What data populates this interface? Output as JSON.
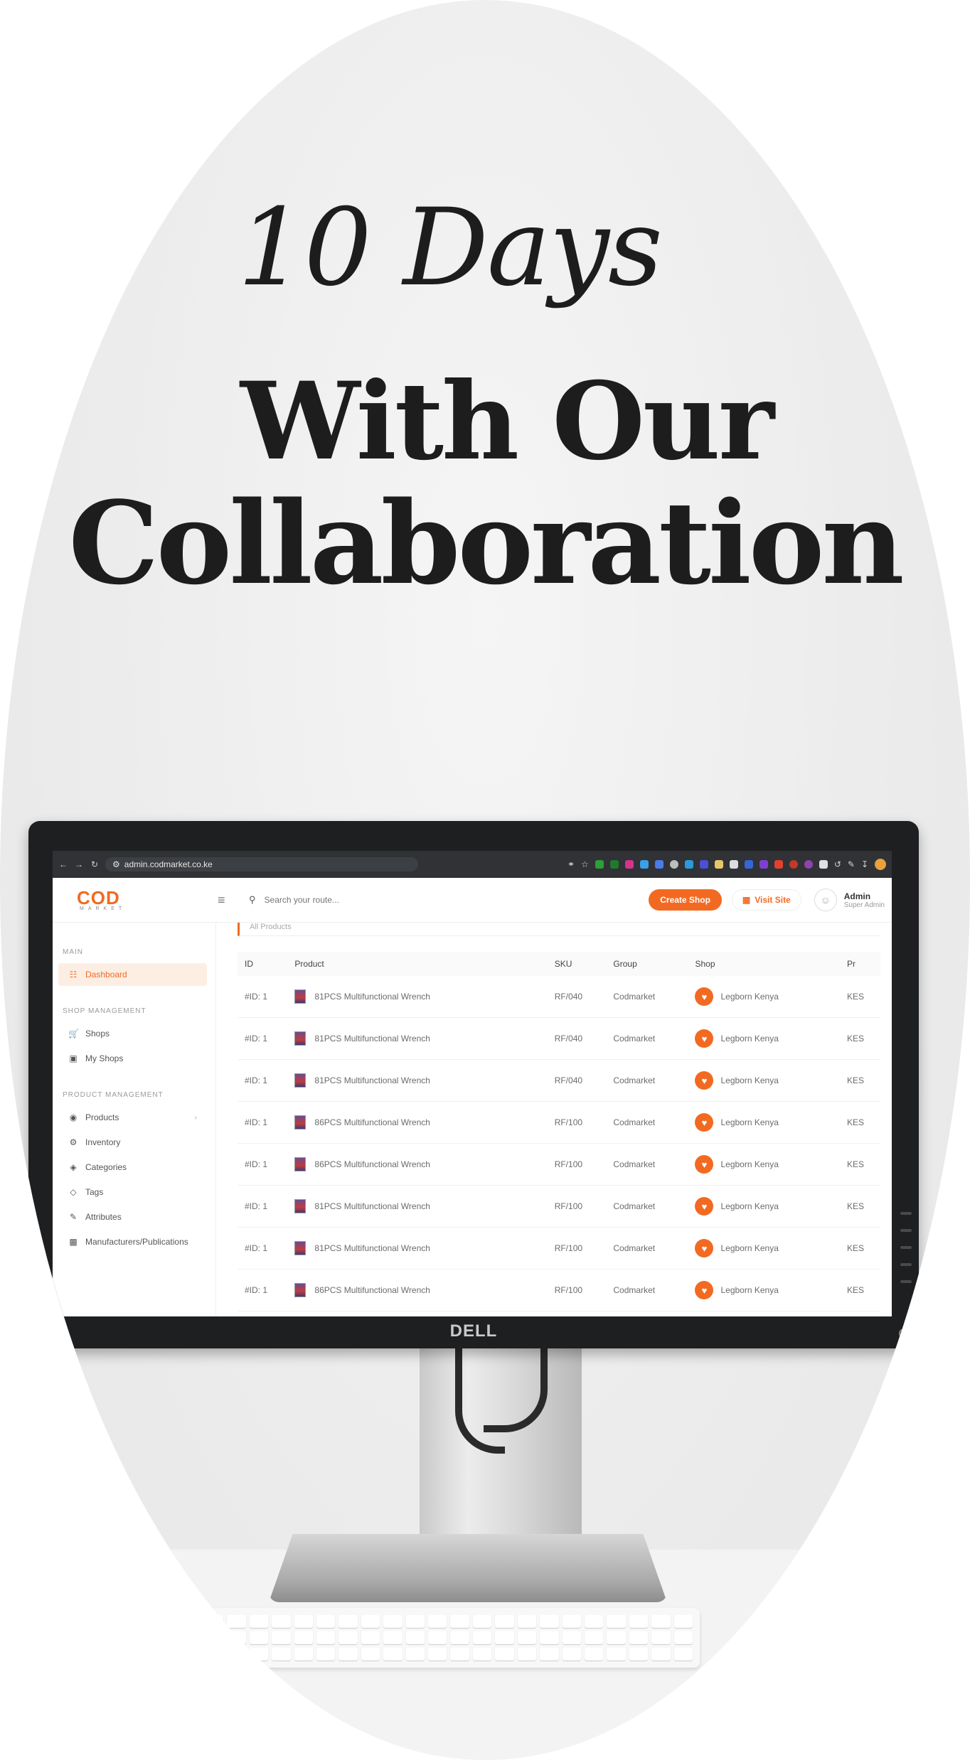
{
  "poster": {
    "line1": "10 Days",
    "line2": "With Our",
    "line3": "Collaboration"
  },
  "monitor": {
    "brand": "DELL"
  },
  "browser": {
    "url": "admin.codmarket.co.ke"
  },
  "app": {
    "logo": "COD",
    "logo_sub": "MARKET",
    "search_placeholder": "Search your route...",
    "create_shop_label": "Create Shop",
    "visit_site_label": "Visit Site",
    "admin_name": "Admin",
    "admin_role": "Super Admin",
    "accent_color": "#f26a21"
  },
  "sidebar": {
    "main_section": "MAIN",
    "dashboard": "Dashboard",
    "shop_section": "SHOP MANAGEMENT",
    "shops": "Shops",
    "my_shops": "My Shops",
    "product_section": "PRODUCT MANAGEMENT",
    "products": "Products",
    "inventory": "Inventory",
    "categories": "Categories",
    "tags": "Tags",
    "attributes": "Attributes",
    "manufacturers": "Manufacturers/Publications"
  },
  "table": {
    "panel_title": "All Products",
    "headers": {
      "id": "ID",
      "product": "Product",
      "sku": "SKU",
      "group": "Group",
      "shop": "Shop",
      "price": "Pr"
    },
    "rows": [
      {
        "id": "#ID: 1",
        "product": "81PCS Multifunctional Wrench",
        "sku": "RF/040",
        "group": "Codmarket",
        "shop": "Legborn Kenya",
        "price": "KES"
      },
      {
        "id": "#ID: 1",
        "product": "81PCS Multifunctional Wrench",
        "sku": "RF/040",
        "group": "Codmarket",
        "shop": "Legborn Kenya",
        "price": "KES"
      },
      {
        "id": "#ID: 1",
        "product": "81PCS Multifunctional Wrench",
        "sku": "RF/040",
        "group": "Codmarket",
        "shop": "Legborn Kenya",
        "price": "KES"
      },
      {
        "id": "#ID: 1",
        "product": "86PCS Multifunctional Wrench",
        "sku": "RF/100",
        "group": "Codmarket",
        "shop": "Legborn Kenya",
        "price": "KES"
      },
      {
        "id": "#ID: 1",
        "product": "86PCS Multifunctional Wrench",
        "sku": "RF/100",
        "group": "Codmarket",
        "shop": "Legborn Kenya",
        "price": "KES"
      },
      {
        "id": "#ID: 1",
        "product": "81PCS Multifunctional Wrench",
        "sku": "RF/100",
        "group": "Codmarket",
        "shop": "Legborn Kenya",
        "price": "KES"
      },
      {
        "id": "#ID: 1",
        "product": "81PCS Multifunctional Wrench",
        "sku": "RF/100",
        "group": "Codmarket",
        "shop": "Legborn Kenya",
        "price": "KES"
      },
      {
        "id": "#ID: 1",
        "product": "86PCS Multifunctional Wrench",
        "sku": "RF/100",
        "group": "Codmarket",
        "shop": "Legborn Kenya",
        "price": "KES"
      }
    ]
  }
}
